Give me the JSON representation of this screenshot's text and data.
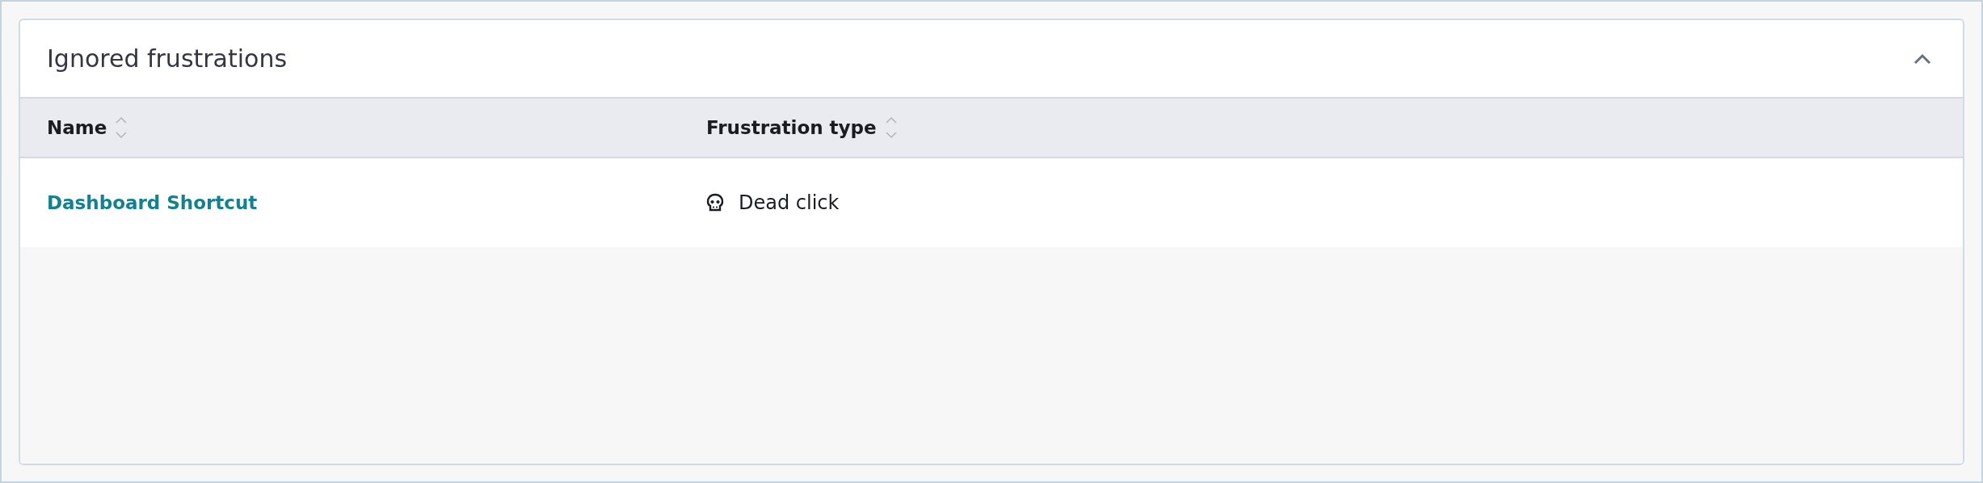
{
  "panel": {
    "title": "Ignored frustrations",
    "expanded": true
  },
  "table": {
    "columns": [
      "Name",
      "Frustration type"
    ],
    "rows": [
      {
        "name": "Dashboard Shortcut",
        "type": {
          "kind": "dead_click",
          "label": "Dead click"
        }
      }
    ]
  }
}
